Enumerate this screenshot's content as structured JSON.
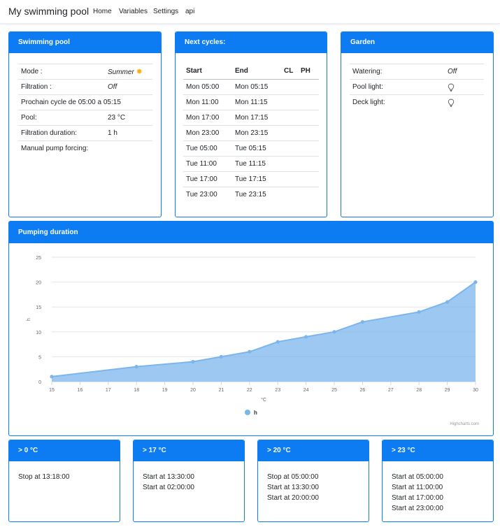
{
  "navbar": {
    "brand": "My swimming pool",
    "links": [
      "Home",
      "Variables",
      "Settings",
      "api"
    ]
  },
  "pool": {
    "title": "Swimming pool",
    "mode_label": "Mode :",
    "mode_value": "Summer",
    "mode_icon": "sun-icon",
    "filtration_label": "Filtration :",
    "filtration_value": "Off",
    "next_cycle": "Prochain cycle de 05:00 a 05:15",
    "pool_label": "Pool:",
    "pool_value": "23 °C",
    "duration_label": "Filtration duration:",
    "duration_value": "1 h",
    "manual_label": "Manual pump forcing:"
  },
  "cycles": {
    "title": "Next cycles:",
    "headers": [
      "Start",
      "End",
      "CL",
      "PH"
    ],
    "rows": [
      [
        "Mon 05:00",
        "Mon 05:15"
      ],
      [
        "Mon 11:00",
        "Mon 11:15"
      ],
      [
        "Mon 17:00",
        "Mon 17:15"
      ],
      [
        "Mon 23:00",
        "Mon 23:15"
      ],
      [
        "Tue 05:00",
        "Tue 05:15"
      ],
      [
        "Tue 11:00",
        "Tue 11:15"
      ],
      [
        "Tue 17:00",
        "Tue 17:15"
      ],
      [
        "Tue 23:00",
        "Tue 23:15"
      ]
    ]
  },
  "garden": {
    "title": "Garden",
    "watering_label": "Watering:",
    "watering_value": "Off",
    "pool_light_label": "Pool light:",
    "deck_light_label": "Deck light:",
    "light_icon": "lightbulb-icon"
  },
  "chart": {
    "title": "Pumping duration",
    "credits": "Highcharts.com"
  },
  "chart_data": {
    "type": "area",
    "xlabel": "°C",
    "ylabel": "h",
    "x_ticks": [
      15,
      16,
      17,
      18,
      19,
      20,
      21,
      22,
      23,
      24,
      25,
      26,
      27,
      28,
      29,
      30
    ],
    "y_ticks": [
      0,
      5,
      10,
      15,
      20,
      25
    ],
    "ylim": [
      0,
      25
    ],
    "grid": true,
    "legend": "bottom-center",
    "series": [
      {
        "name": "h",
        "color": "#7cb5ec",
        "points": [
          [
            15,
            1
          ],
          [
            18,
            3
          ],
          [
            20,
            4
          ],
          [
            21,
            5
          ],
          [
            22,
            6
          ],
          [
            23,
            8
          ],
          [
            24,
            9
          ],
          [
            25,
            10
          ],
          [
            26,
            12
          ],
          [
            28,
            14
          ],
          [
            29,
            16
          ],
          [
            30,
            20
          ]
        ]
      }
    ]
  },
  "ranges": [
    {
      "title": "> 0 °C",
      "lines": [
        "Stop at 13:18:00"
      ]
    },
    {
      "title": "> 17 °C",
      "lines": [
        "Start at 13:30:00",
        "Start at 02:00:00"
      ]
    },
    {
      "title": "> 20 °C",
      "lines": [
        "Stop at 05:00:00",
        "Start at 13:30:00",
        "Start at 20:00:00"
      ]
    },
    {
      "title": "> 23 °C",
      "lines": [
        "Start at 05:00:00",
        "Start at 11:00:00",
        "Start at 17:00:00",
        "Start at 23:00:00"
      ]
    }
  ],
  "colors": {
    "primary": "#0d7cf2",
    "series": "#7cb5ec",
    "sun": "#f5b31a"
  }
}
